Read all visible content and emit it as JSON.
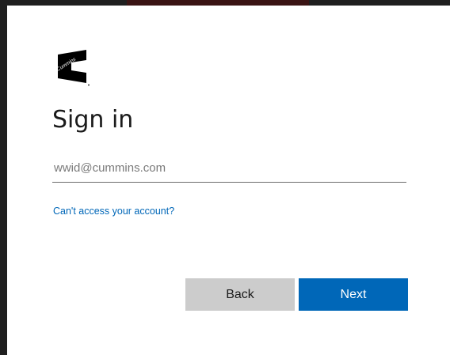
{
  "brand": {
    "logo_text": "Cummins",
    "accent": "#0067b8",
    "logo_color": "#000000"
  },
  "signin": {
    "title": "Sign in",
    "email_placeholder": "wwid@cummins.com",
    "email_value": "",
    "cant_access_link": "Can't access your account?",
    "back_label": "Back",
    "next_label": "Next"
  },
  "colors": {
    "back_button": "#cccccc",
    "next_button": "#0067b8",
    "link": "#0067b8"
  }
}
